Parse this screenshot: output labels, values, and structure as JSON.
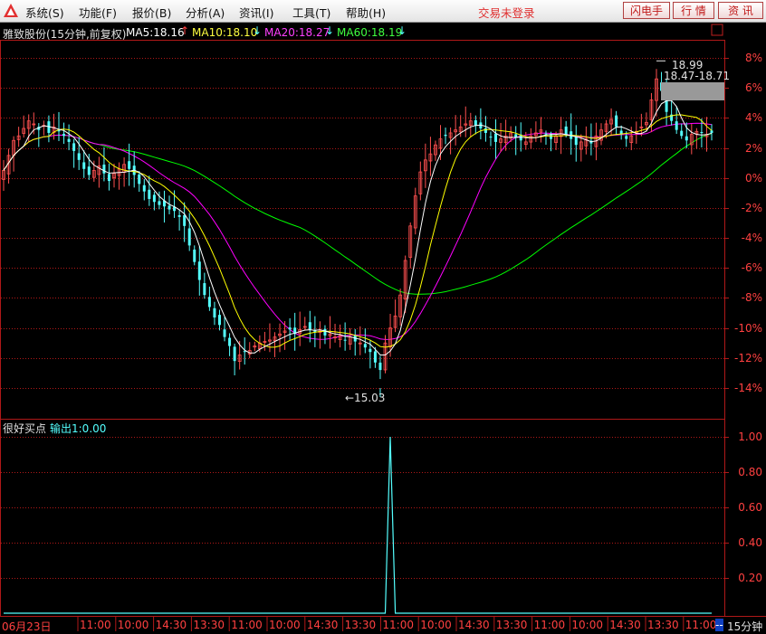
{
  "menu": {
    "items": [
      "系统(S)",
      "功能(F)",
      "报价(B)",
      "分析(A)",
      "资讯(I)",
      "工具(T)",
      "帮助(H)"
    ],
    "login_status": "交易未登录",
    "buttons": [
      "闪电手",
      "行 情",
      "资 讯"
    ]
  },
  "header": {
    "stock_info": "雅致股份(15分钟,前复权)",
    "ma5": "MA5:18.16",
    "ma10": "MA10:18.10",
    "ma20": "MA20:18.27",
    "ma60": "MA60:18.19",
    "ma5_arrow": "↑",
    "ma10_arrow": "↓",
    "ma20_arrow": "↓",
    "ma60_arrow": "↓",
    "corner_box": "□"
  },
  "colors": {
    "background": "#000000",
    "grid_red": "#b01818",
    "up_candle": "#ff5050",
    "down_candle": "#54ffff",
    "ma5": "#ffffff",
    "ma10": "#ffff00",
    "ma20": "#ff00ff",
    "ma60": "#00ff00",
    "signal": "#54ffff"
  },
  "price_axis": {
    "ticks": [
      "8%",
      "6%",
      "4%",
      "2%",
      "0%",
      "-2%",
      "-4%",
      "-6%",
      "-8%",
      "-10%",
      "-12%",
      "-14%"
    ],
    "tick_values": [
      8,
      6,
      4,
      2,
      0,
      -2,
      -4,
      -6,
      -8,
      -10,
      -12,
      -14
    ]
  },
  "annotations": {
    "high_label": "18.99",
    "range_label": "18.47-18.71",
    "low_label": "←15.03"
  },
  "indicator": {
    "name": "很好买点",
    "output": "输出1:0.00",
    "ticks": [
      "1.00",
      "0.80",
      "0.60",
      "0.40",
      "0.20"
    ],
    "tick_values": [
      1.0,
      0.8,
      0.6,
      0.4,
      0.2
    ]
  },
  "time_axis": {
    "date_label": "06月23日",
    "labels": [
      "11:00",
      "10:00",
      "14:30",
      "13:30",
      "11:00",
      "10:00",
      "14:30",
      "13:30",
      "11:00",
      "10:00",
      "14:30",
      "13:30",
      "11:00",
      "10:00",
      "14:30",
      "13:30",
      "11:00"
    ],
    "period": "15分钟",
    "period_marker": "--"
  },
  "chart_data": {
    "type": "candlestick",
    "yrange_pct": [
      -15,
      9
    ],
    "description_ma": [
      "MA5",
      "MA10",
      "MA20",
      "MA60"
    ],
    "close_pct": [
      0.5,
      1.5,
      2.5,
      2.8,
      3.3,
      3.8,
      3.6,
      3.2,
      3.5,
      3.0,
      3.4,
      3.1,
      2.8,
      2.4,
      1.8,
      1.2,
      0.6,
      0.2,
      0.5,
      0.8,
      0.3,
      -0.2,
      0.3,
      0.6,
      0.9,
      0.6,
      0.2,
      -0.4,
      -0.9,
      -1.4,
      -1.6,
      -1.8,
      -1.9,
      -2.1,
      -2.2,
      -2.6,
      -3.2,
      -4.5,
      -5.6,
      -6.8,
      -7.8,
      -8.6,
      -9.3,
      -9.8,
      -10.6,
      -11.2,
      -12.2,
      -11.8,
      -11.6,
      -11.5,
      -11.2,
      -11.0,
      -10.9,
      -10.8,
      -10.6,
      -10.4,
      -10.2,
      -10.1,
      -10.4,
      -10.1,
      -9.9,
      -10.1,
      -10.3,
      -10.2,
      -10.5,
      -10.4,
      -10.6,
      -10.5,
      -10.8,
      -10.6,
      -10.9,
      -11.0,
      -11.3,
      -11.6,
      -12.3,
      -12.8,
      -11.0,
      -10.0,
      -9.2,
      -7.8,
      -5.5,
      -3.2,
      -1.2,
      0.4,
      1.2,
      1.6,
      2.2,
      2.6,
      2.8,
      3.0,
      3.2,
      3.4,
      3.6,
      3.8,
      3.5,
      3.3,
      3.0,
      2.7,
      2.4,
      2.6,
      2.8,
      3.0,
      2.7,
      2.5,
      2.4,
      2.8,
      3.0,
      3.2,
      2.9,
      2.6,
      2.8,
      3.2,
      2.9,
      2.6,
      2.2,
      2.4,
      2.6,
      2.3,
      2.8,
      3.2,
      3.6,
      3.9,
      3.4,
      2.9,
      2.6,
      2.8,
      3.1,
      3.4,
      3.7,
      5.2,
      6.6,
      5.8,
      4.4,
      3.8,
      3.2,
      2.8,
      2.5,
      2.9,
      3.1,
      3.0,
      2.9,
      3.0
    ],
    "high_low_markers": {
      "high_price": 18.99,
      "low_price": 15.03
    },
    "signal": {
      "name": "很好买点",
      "spike_value": 1.0,
      "baseline": 0.0,
      "current_output": 0.0
    }
  }
}
